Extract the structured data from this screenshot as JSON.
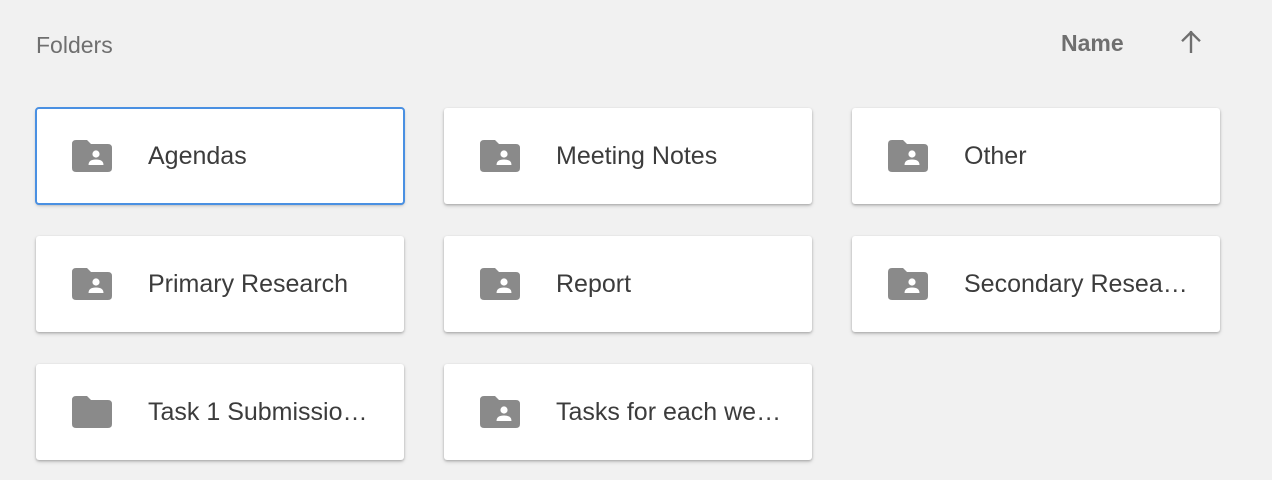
{
  "header": {
    "title": "Folders",
    "sort_label": "Name",
    "sort_icon": "arrow-up-icon"
  },
  "colors": {
    "background": "#f1f1f1",
    "card": "#ffffff",
    "icon": "#8a8a8a",
    "selected_border": "#4a90e2",
    "text": "#3c3c3c"
  },
  "folders": [
    {
      "label": "Agendas",
      "icon": "shared-folder-icon",
      "selected": true
    },
    {
      "label": "Meeting Notes",
      "icon": "shared-folder-icon",
      "selected": false
    },
    {
      "label": "Other",
      "icon": "shared-folder-icon",
      "selected": false
    },
    {
      "label": "Primary Research",
      "icon": "shared-folder-icon",
      "selected": false
    },
    {
      "label": "Report",
      "icon": "shared-folder-icon",
      "selected": false
    },
    {
      "label": "Secondary Resear…",
      "icon": "shared-folder-icon",
      "selected": false
    },
    {
      "label": "Task 1 Submissio…",
      "icon": "folder-icon",
      "selected": false
    },
    {
      "label": "Tasks for each we…",
      "icon": "shared-folder-icon",
      "selected": false
    }
  ]
}
